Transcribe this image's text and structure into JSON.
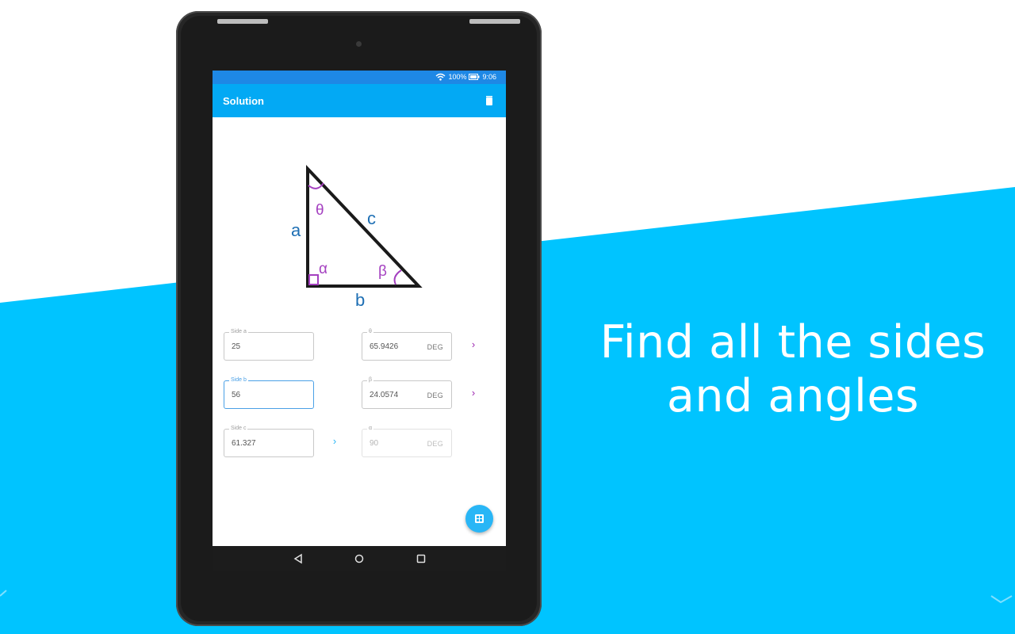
{
  "background": {
    "accent": "#00c4ff"
  },
  "headline": {
    "line1": "Find all the sides",
    "line2": "and angles"
  },
  "status": {
    "battery": "100%",
    "time": "9:06",
    "icons": [
      "wifi-icon",
      "battery-icon"
    ]
  },
  "appbar": {
    "title": "Solution",
    "action_icon": "trash-icon"
  },
  "diagram": {
    "side_a": "a",
    "side_b": "b",
    "side_c": "c",
    "angle_theta": "θ",
    "angle_alpha": "α",
    "angle_beta": "β",
    "side_color": "#1e6fb4",
    "angle_color": "#a440c0"
  },
  "fields": {
    "side_a": {
      "label": "Side a",
      "value": "25"
    },
    "side_b": {
      "label": "Side b",
      "value": "56"
    },
    "side_c": {
      "label": "Side c",
      "value": "61.327"
    },
    "theta": {
      "label": "θ",
      "value": "65.9426",
      "unit": "DEG"
    },
    "beta": {
      "label": "β",
      "value": "24.0574",
      "unit": "DEG"
    },
    "alpha": {
      "label": "α",
      "value": "90",
      "unit": "DEG"
    }
  },
  "chevron": "›",
  "fab_icon": "calculator-icon",
  "navbar": {
    "icons": [
      "back-icon",
      "home-icon",
      "recents-icon"
    ]
  }
}
